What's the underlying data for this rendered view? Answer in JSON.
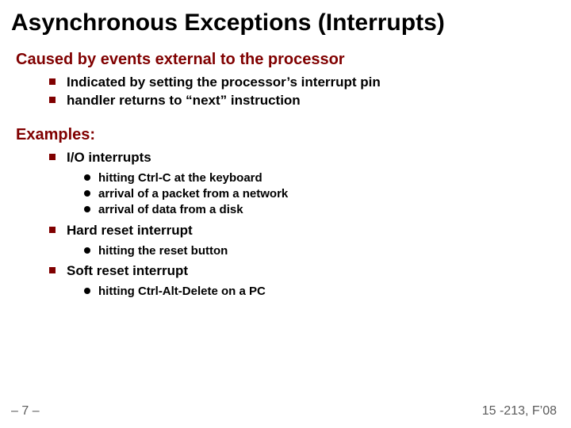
{
  "title": "Asynchronous Exceptions (Interrupts)",
  "section1": {
    "heading": "Caused by events external to the processor",
    "items": [
      "Indicated by setting the processor’s interrupt pin",
      "handler returns to “next” instruction"
    ]
  },
  "section2": {
    "heading": "Examples:",
    "groups": [
      {
        "label": "I/O interrupts",
        "subs": [
          "hitting Ctrl-C at the keyboard",
          "arrival of a packet from a network",
          "arrival of data from a disk"
        ]
      },
      {
        "label": "Hard reset interrupt",
        "subs": [
          "hitting the reset button"
        ]
      },
      {
        "label": "Soft reset interrupt",
        "subs": [
          "hitting Ctrl-Alt-Delete on a PC"
        ]
      }
    ]
  },
  "footer": {
    "left": "– 7 –",
    "right": "15 -213, F’08"
  }
}
